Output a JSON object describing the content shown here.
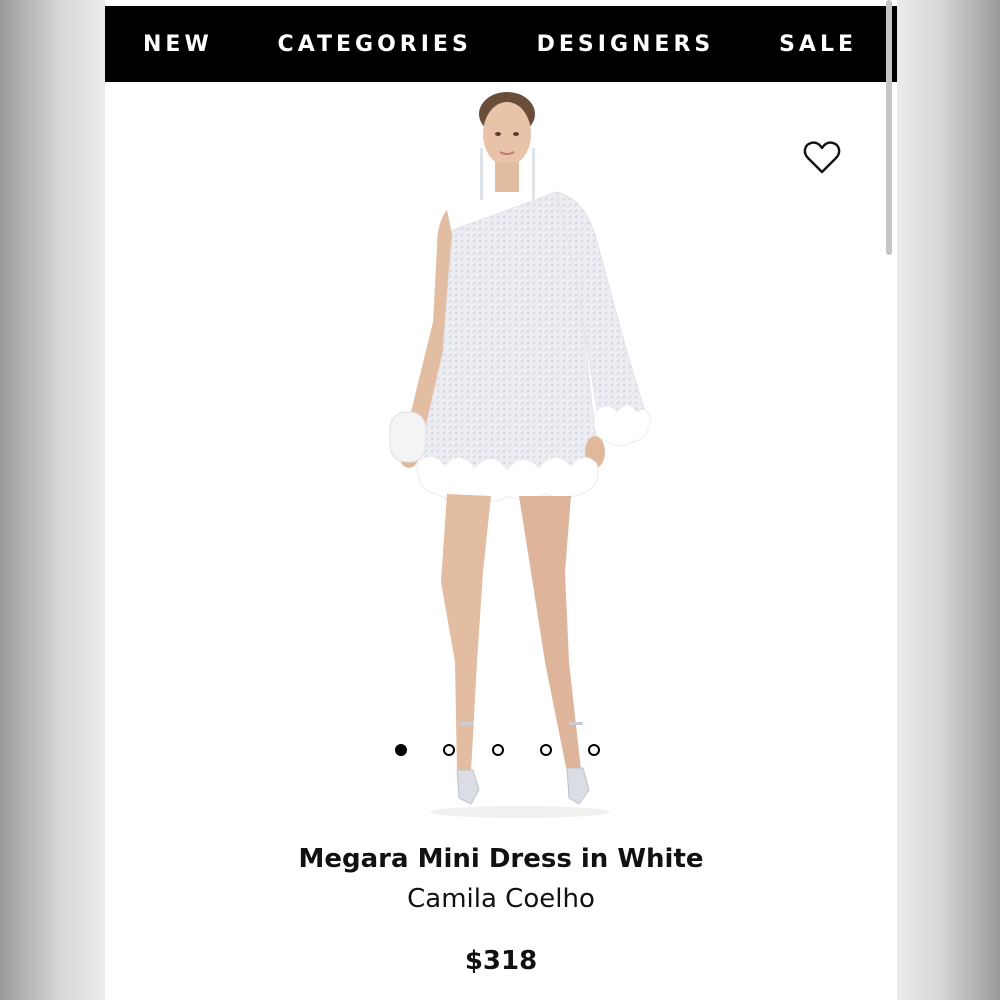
{
  "nav": {
    "items": [
      {
        "label": "NEW"
      },
      {
        "label": "CATEGORIES"
      },
      {
        "label": "DESIGNERS"
      },
      {
        "label": "SALE"
      }
    ]
  },
  "product": {
    "title": "Megara Mini Dress in White",
    "brand": "Camila Coelho",
    "price": "$318",
    "wishlist_icon": "heart-outline-icon",
    "image_description_icon": "product-photo",
    "carousel": {
      "total": 5,
      "active_index": 0
    }
  },
  "colors": {
    "nav_background": "#000000",
    "nav_text": "#ffffff",
    "text": "#111111"
  }
}
